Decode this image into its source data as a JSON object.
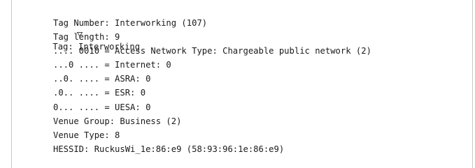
{
  "tree": {
    "header": {
      "label": "Tag: Interworking"
    },
    "fields": [
      "Tag Number: Interworking (107)",
      "Tag length: 9",
      ".... 0010 = Access Network Type: Chargeable public network (2)",
      "...0 .... = Internet: 0",
      "..0. .... = ASRA: 0",
      ".0.. .... = ESR: 0",
      "0... .... = UESA: 0",
      "Venue Group: Business (2)",
      "Venue Type: 8",
      "HESSID: RuckusWi_1e:86:e9 (58:93:96:1e:86:e9)"
    ]
  },
  "colors": {
    "text": "#1a1a1a",
    "background": "#ffffff"
  },
  "icons": {
    "expander": "triangle-expanded-icon"
  }
}
